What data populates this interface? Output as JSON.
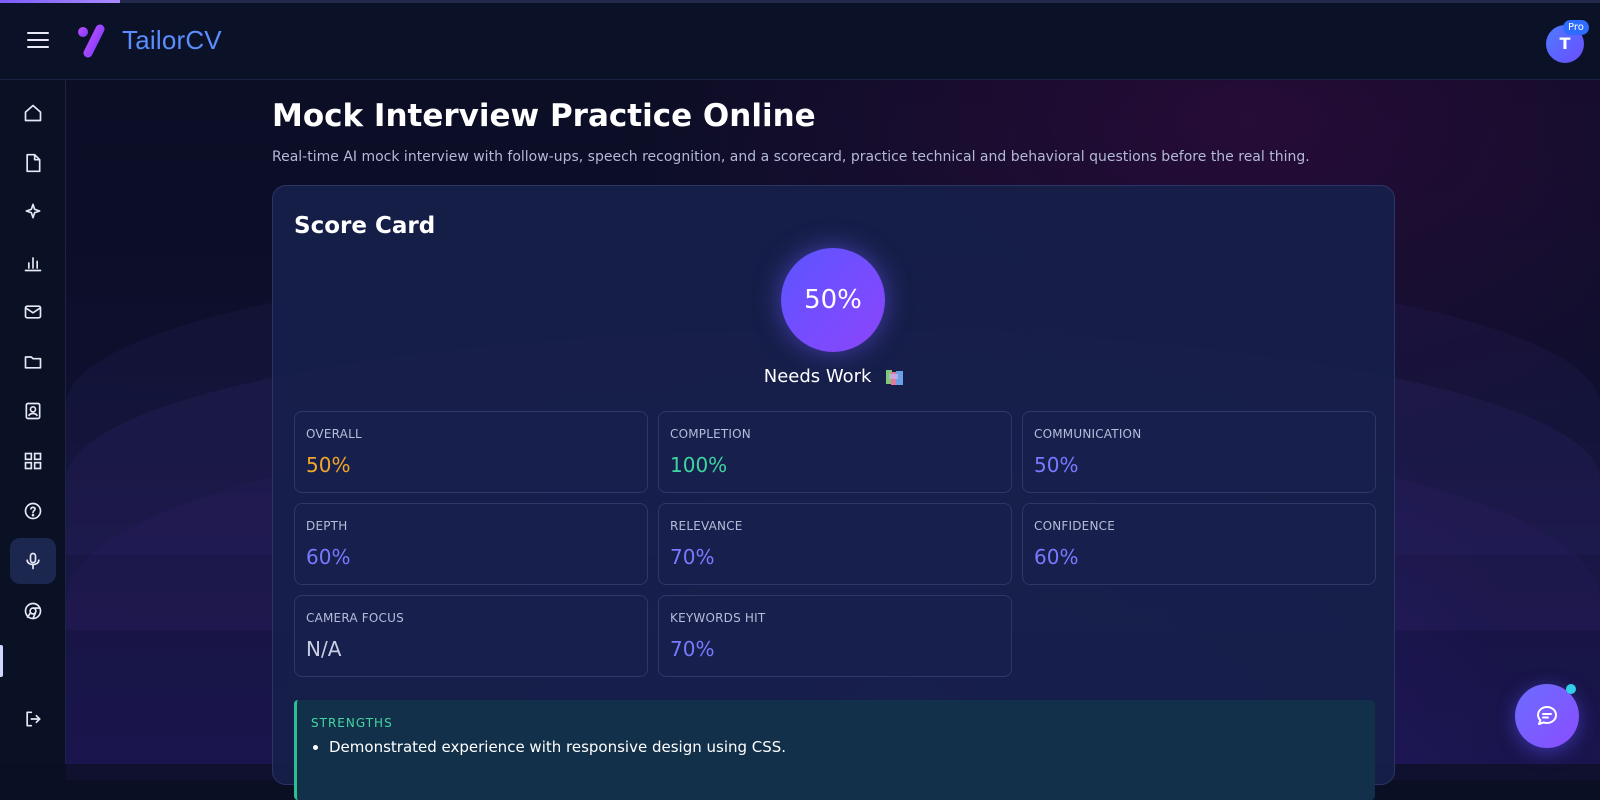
{
  "app": {
    "name": "TailorCV",
    "user_initial": "T",
    "plan_badge": "Pro"
  },
  "sidebar": {
    "items": [
      {
        "icon": "home-icon"
      },
      {
        "icon": "document-icon"
      },
      {
        "icon": "sparkle-icon"
      },
      {
        "icon": "bar-chart-icon"
      },
      {
        "icon": "mail-icon"
      },
      {
        "icon": "folder-icon"
      },
      {
        "icon": "contact-card-icon"
      },
      {
        "icon": "grid-icon"
      },
      {
        "icon": "help-icon"
      },
      {
        "icon": "microphone-icon",
        "active": true
      },
      {
        "icon": "chrome-icon"
      }
    ],
    "footer_icon": "logout-icon"
  },
  "page": {
    "title": "Mock Interview Practice Online",
    "subtitle": "Real-time AI mock interview with follow-ups, speech recognition, and a scorecard, practice technical and behavioral questions before the real thing."
  },
  "scorecard": {
    "title": "Score Card",
    "score": "50%",
    "verdict": "Needs Work",
    "metrics": [
      {
        "label": "OVERALL",
        "value": "50%",
        "color": "#f4a52b"
      },
      {
        "label": "COMPLETION",
        "value": "100%",
        "color": "#3ed4a0"
      },
      {
        "label": "COMMUNICATION",
        "value": "50%",
        "color": "#7a78ff"
      },
      {
        "label": "DEPTH",
        "value": "60%",
        "color": "#7a78ff"
      },
      {
        "label": "RELEVANCE",
        "value": "70%",
        "color": "#7a78ff"
      },
      {
        "label": "CONFIDENCE",
        "value": "60%",
        "color": "#7a78ff"
      },
      {
        "label": "CAMERA FOCUS",
        "value": "N/A",
        "color": "#c9cde2"
      },
      {
        "label": "KEYWORDS HIT",
        "value": "70%",
        "color": "#7a78ff"
      }
    ],
    "strengths": {
      "title": "STRENGTHS",
      "items": [
        "Demonstrated experience with responsive design using CSS."
      ]
    }
  },
  "colors": {
    "accent": "#6b5cff",
    "brand": "#5c8dff",
    "success": "#3ed4a0",
    "warning": "#f4a52b"
  }
}
